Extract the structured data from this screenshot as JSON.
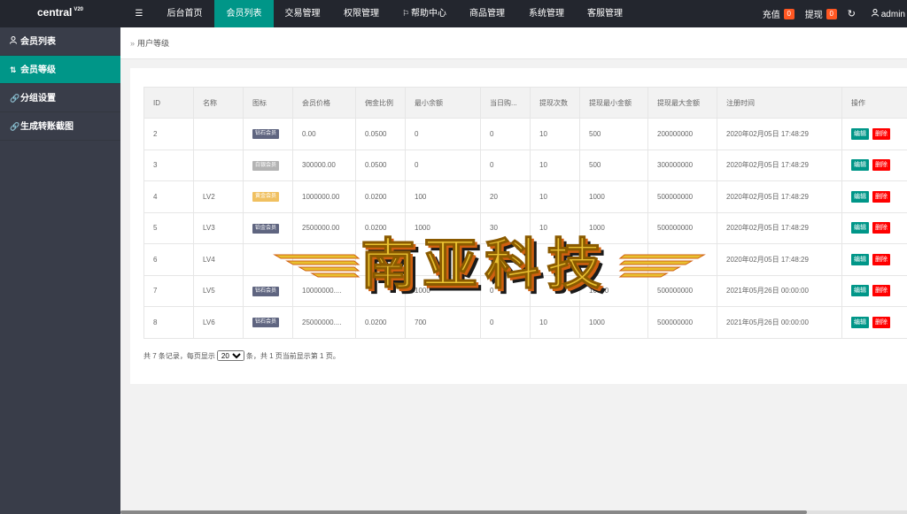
{
  "app": {
    "logo": "central",
    "version": "V20"
  },
  "topnav": {
    "toggle_icon": "menu-icon",
    "items": [
      {
        "label": "后台首页",
        "active": false
      },
      {
        "label": "会员列表",
        "active": true
      },
      {
        "label": "交易管理",
        "active": false
      },
      {
        "label": "权限管理",
        "active": false
      },
      {
        "label": "帮助中心",
        "active": false,
        "icon": "flag-icon"
      },
      {
        "label": "商品管理",
        "active": false
      },
      {
        "label": "系统管理",
        "active": false
      },
      {
        "label": "客服管理",
        "active": false
      }
    ],
    "recharge_label": "充值",
    "recharge_count": "0",
    "withdraw_label": "提现",
    "withdraw_count": "0",
    "user_label": "admin"
  },
  "sidebar": {
    "items": [
      {
        "label": "会员列表",
        "icon": "user-icon",
        "active": false
      },
      {
        "label": "会员等级",
        "icon": "sort-icon",
        "active": true
      },
      {
        "label": "分组设置",
        "icon": "link-icon",
        "active": false
      },
      {
        "label": "生成转账截图",
        "icon": "link-icon",
        "active": false
      }
    ]
  },
  "breadcrumb": {
    "label": "用户等级"
  },
  "table": {
    "headers": [
      "ID",
      "名称",
      "图标",
      "会员价格",
      "佣金比例",
      "最小余额",
      "当日购...",
      "提现次数",
      "提现最小金额",
      "提现最大金额",
      "注册时间",
      "操作"
    ],
    "edit_label": "编辑",
    "delete_label": "删除",
    "rows": [
      {
        "id": "2",
        "name": "",
        "tag": "钻石会员",
        "tag_color": "#5f6580",
        "price": "0.00",
        "ratio": "0.0500",
        "min_balance": "0",
        "daily": "0",
        "withdraw_times": "10",
        "withdraw_min": "500",
        "withdraw_max": "200000000",
        "time": "2020年02月05日 17:48:29"
      },
      {
        "id": "3",
        "name": "",
        "tag": "白银会员",
        "tag_color": "#b3b3b3",
        "price": "300000.00",
        "ratio": "0.0500",
        "min_balance": "0",
        "daily": "0",
        "withdraw_times": "10",
        "withdraw_min": "500",
        "withdraw_max": "300000000",
        "time": "2020年02月05日 17:48:29"
      },
      {
        "id": "4",
        "name": "LV2",
        "tag": "黄金会员",
        "tag_color": "#f0c060",
        "price": "1000000.00",
        "ratio": "0.0200",
        "min_balance": "100",
        "daily": "20",
        "withdraw_times": "10",
        "withdraw_min": "1000",
        "withdraw_max": "500000000",
        "time": "2020年02月05日 17:48:29"
      },
      {
        "id": "5",
        "name": "LV3",
        "tag": "铂金会员",
        "tag_color": "#5f6580",
        "price": "2500000.00",
        "ratio": "0.0200",
        "min_balance": "1000",
        "daily": "30",
        "withdraw_times": "10",
        "withdraw_min": "1000",
        "withdraw_max": "500000000",
        "time": "2020年02月05日 17:48:29"
      },
      {
        "id": "6",
        "name": "LV4",
        "tag": "",
        "tag_color": "#5f6580",
        "price": "",
        "ratio": "",
        "min_balance": "",
        "daily": "4",
        "withdraw_times": "",
        "withdraw_min": "",
        "withdraw_max": "",
        "time": "2020年02月05日 17:48:29"
      },
      {
        "id": "7",
        "name": "LV5",
        "tag": "钻石会员",
        "tag_color": "#5f6580",
        "price": "10000000....",
        "ratio": "",
        "min_balance": "1000",
        "daily": "0",
        "withdraw_times": "",
        "withdraw_min": "10000",
        "withdraw_max": "500000000",
        "time": "2021年05月26日 00:00:00"
      },
      {
        "id": "8",
        "name": "LV6",
        "tag": "钻石会员",
        "tag_color": "#5f6580",
        "price": "25000000....",
        "ratio": "0.0200",
        "min_balance": "700",
        "daily": "0",
        "withdraw_times": "10",
        "withdraw_min": "1000",
        "withdraw_max": "500000000",
        "time": "2021年05月26日 00:00:00"
      }
    ]
  },
  "pager": {
    "prefix": "共 7 条记录，每页显示",
    "page_size": "20",
    "suffix": "条，共 1 页当前显示第 1 页。"
  },
  "watermark": {
    "text": "南亚科技",
    "colors": {
      "face": "#e8c030",
      "shadow": "#d06010",
      "dark": "#1a1a1a"
    }
  },
  "colors": {
    "accent": "#009688",
    "topbar": "#23262e",
    "sidebar": "#393d49",
    "badge": "#ff5722",
    "delete": "#ff0000"
  }
}
